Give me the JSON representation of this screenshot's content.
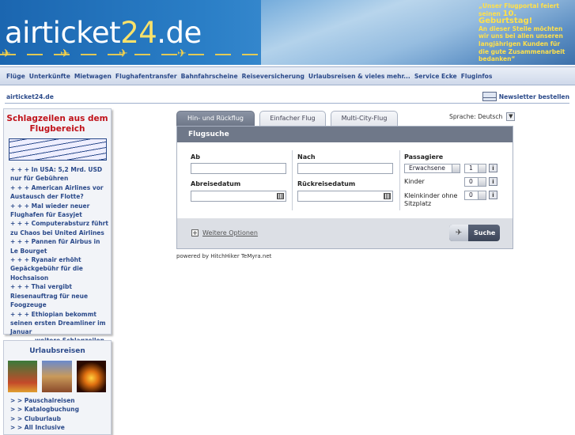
{
  "banner": {
    "logo_prefix": "airticket",
    "logo_number": "24",
    "logo_suffix": ".de",
    "promo_line1": "„Unser Flugportal feiert",
    "promo_line2_prefix": "seinen ",
    "promo_big": "10. Geburtstag!",
    "promo_rest": "An dieser Stelle möchten wir uns bei allen unseren langjährigen Kunden für die gute Zusammenarbeit bedanken“"
  },
  "nav": {
    "items": [
      "Flüge",
      "Unterkünfte",
      "Mietwagen",
      "Flughafentransfer",
      "Bahnfahrscheine",
      "Reiseversicherung",
      "Urlaubsreisen & vieles mehr...",
      "Service Ecke",
      "Fluginfos"
    ]
  },
  "crumb": {
    "site": "airticket24.de",
    "newsletter": "Newsletter bestellen"
  },
  "news": {
    "title": "Schlagzeilen aus dem Flugbereich",
    "items": [
      "+ + + In USA: 5,2 Mrd. USD nur für Gebühren",
      "+ + + American Airlines vor Austausch der Flotte?",
      "+ + + Mal wieder neuer Flughafen für Easyjet",
      "+ + + Computerabsturz führt zu Chaos bei United Airlines",
      "+ + + Pannen für Airbus in Le Bourget",
      "+ + + Ryanair erhöht Gepäckgebühr für die Hochsaison",
      "+ + + Thai vergibt Riesenauftrag für neue Foogzeuge",
      "+ + + Ethiopian bekommt seinen ersten Dreamliner im Januar"
    ],
    "more": "weitere Schlagzeilen"
  },
  "travel": {
    "title": "Urlaubsreisen",
    "items": [
      "> > Pauschalreisen",
      "> > Katalogbuchung",
      "> > Cluburlaub",
      "> > All Inclusive"
    ]
  },
  "tabs": [
    "Hin- und Rückflug",
    "Einfacher Flug",
    "Multi-City-Flug"
  ],
  "language": {
    "label": "Sprache:",
    "value": "Deutsch"
  },
  "form": {
    "heading": "Flugsuche",
    "from_label": "Ab",
    "to_label": "Nach",
    "depart_label": "Abreisedatum",
    "return_label": "Rückreisedatum",
    "from_value": "",
    "to_value": "",
    "depart_value": "",
    "return_value": "",
    "passengers_label": "Passagiere",
    "adult_type": "Erwachsene",
    "adult_count": "1",
    "children_label": "Kinder",
    "children_count": "0",
    "infants_label": "Kleinkinder ohne Sitzplatz",
    "infants_count": "0",
    "info_glyph": "i",
    "more_options": "Weitere Optionen",
    "search_label": "Suche"
  },
  "powered_by": "powered by HitchHiker TeMyra.net"
}
